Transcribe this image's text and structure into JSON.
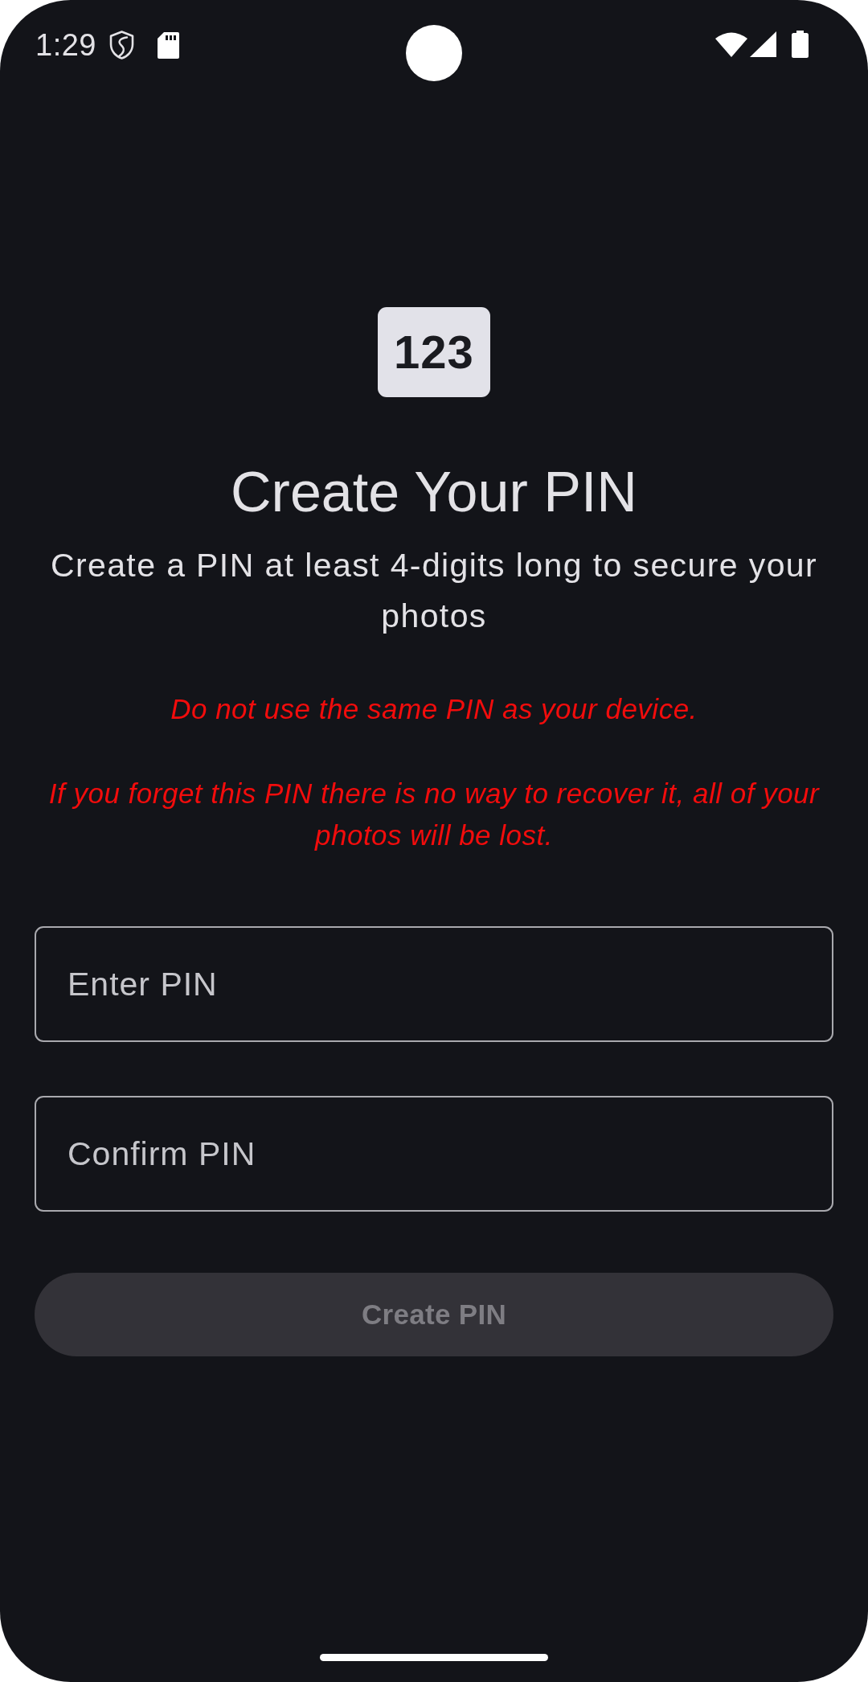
{
  "status_bar": {
    "time": "1:29"
  },
  "logo": {
    "text": "123"
  },
  "title": "Create Your PIN",
  "subtitle": "Create a PIN at least 4-digits long to secure your photos",
  "warnings": [
    "Do not use the same PIN as your device.",
    "If you forget this PIN there is no way to recover it, all of your photos will be lost."
  ],
  "fields": [
    {
      "placeholder": "Enter PIN"
    },
    {
      "placeholder": "Confirm PIN"
    }
  ],
  "button": {
    "label": "Create PIN",
    "disabled": true
  }
}
